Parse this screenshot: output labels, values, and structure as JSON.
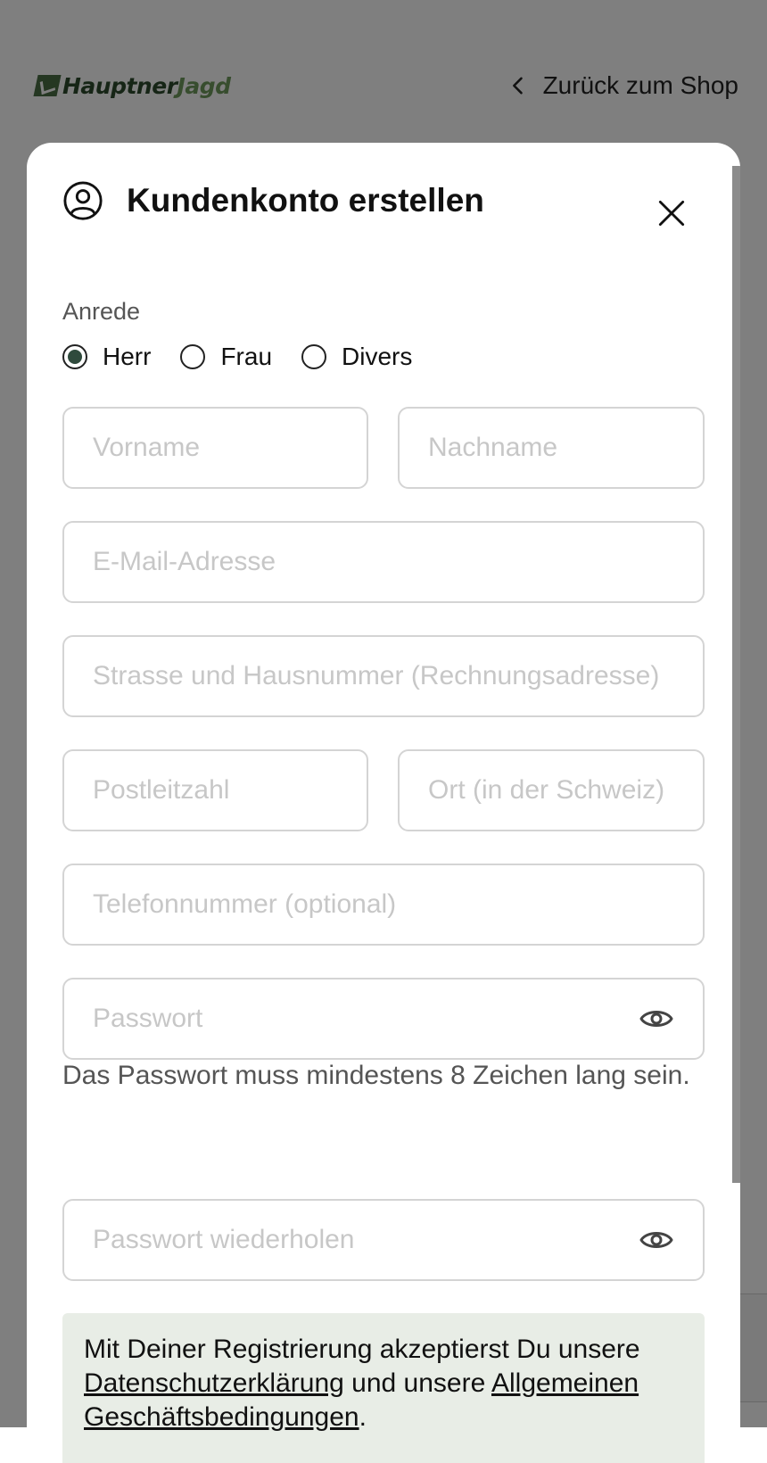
{
  "header": {
    "logo": {
      "text_main": "Hauptner",
      "text_accent": "Jagd",
      "icon": "logo-mark"
    },
    "back_link": {
      "label": "Zurück zum Shop",
      "icon": "chevron-left-icon"
    }
  },
  "modal": {
    "title": "Kundenkonto erstellen",
    "title_icon": "user-circle-icon",
    "close_icon": "close-icon",
    "anrede": {
      "label": "Anrede",
      "options": [
        {
          "label": "Herr",
          "checked": true
        },
        {
          "label": "Frau",
          "checked": false
        },
        {
          "label": "Divers",
          "checked": false
        }
      ]
    },
    "fields": {
      "vorname": {
        "placeholder": "Vorname",
        "value": ""
      },
      "nachname": {
        "placeholder": "Nachname",
        "value": ""
      },
      "email": {
        "placeholder": "E-Mail-Adresse",
        "value": ""
      },
      "strasse": {
        "placeholder": "Strasse und Hausnummer (Rechnungsadresse)",
        "value": ""
      },
      "plz": {
        "placeholder": "Postleitzahl",
        "value": ""
      },
      "ort": {
        "placeholder": "Ort (in der Schweiz)",
        "value": ""
      },
      "telefon": {
        "placeholder": "Telefonnummer (optional)",
        "value": ""
      },
      "passwort": {
        "placeholder": "Passwort",
        "value": ""
      },
      "passwort_wdh": {
        "placeholder": "Passwort wiederholen",
        "value": ""
      }
    },
    "password_hint": "Das Passwort muss mindestens 8 Zeichen lang sein.",
    "notice": {
      "text_1": "Mit Deiner Registrierung akzeptierst Du unsere",
      "link_privacy": "Datenschutzerklärung",
      "text_2": "und unsere",
      "link_terms": "Allgemeinen Geschäftsbedingungen",
      "text_3": "."
    }
  },
  "colors": {
    "brand_green": "#2f4a3c",
    "notice_bg": "#e8ede6",
    "placeholder": "#c7c7c7",
    "border": "#d4d4d4"
  }
}
